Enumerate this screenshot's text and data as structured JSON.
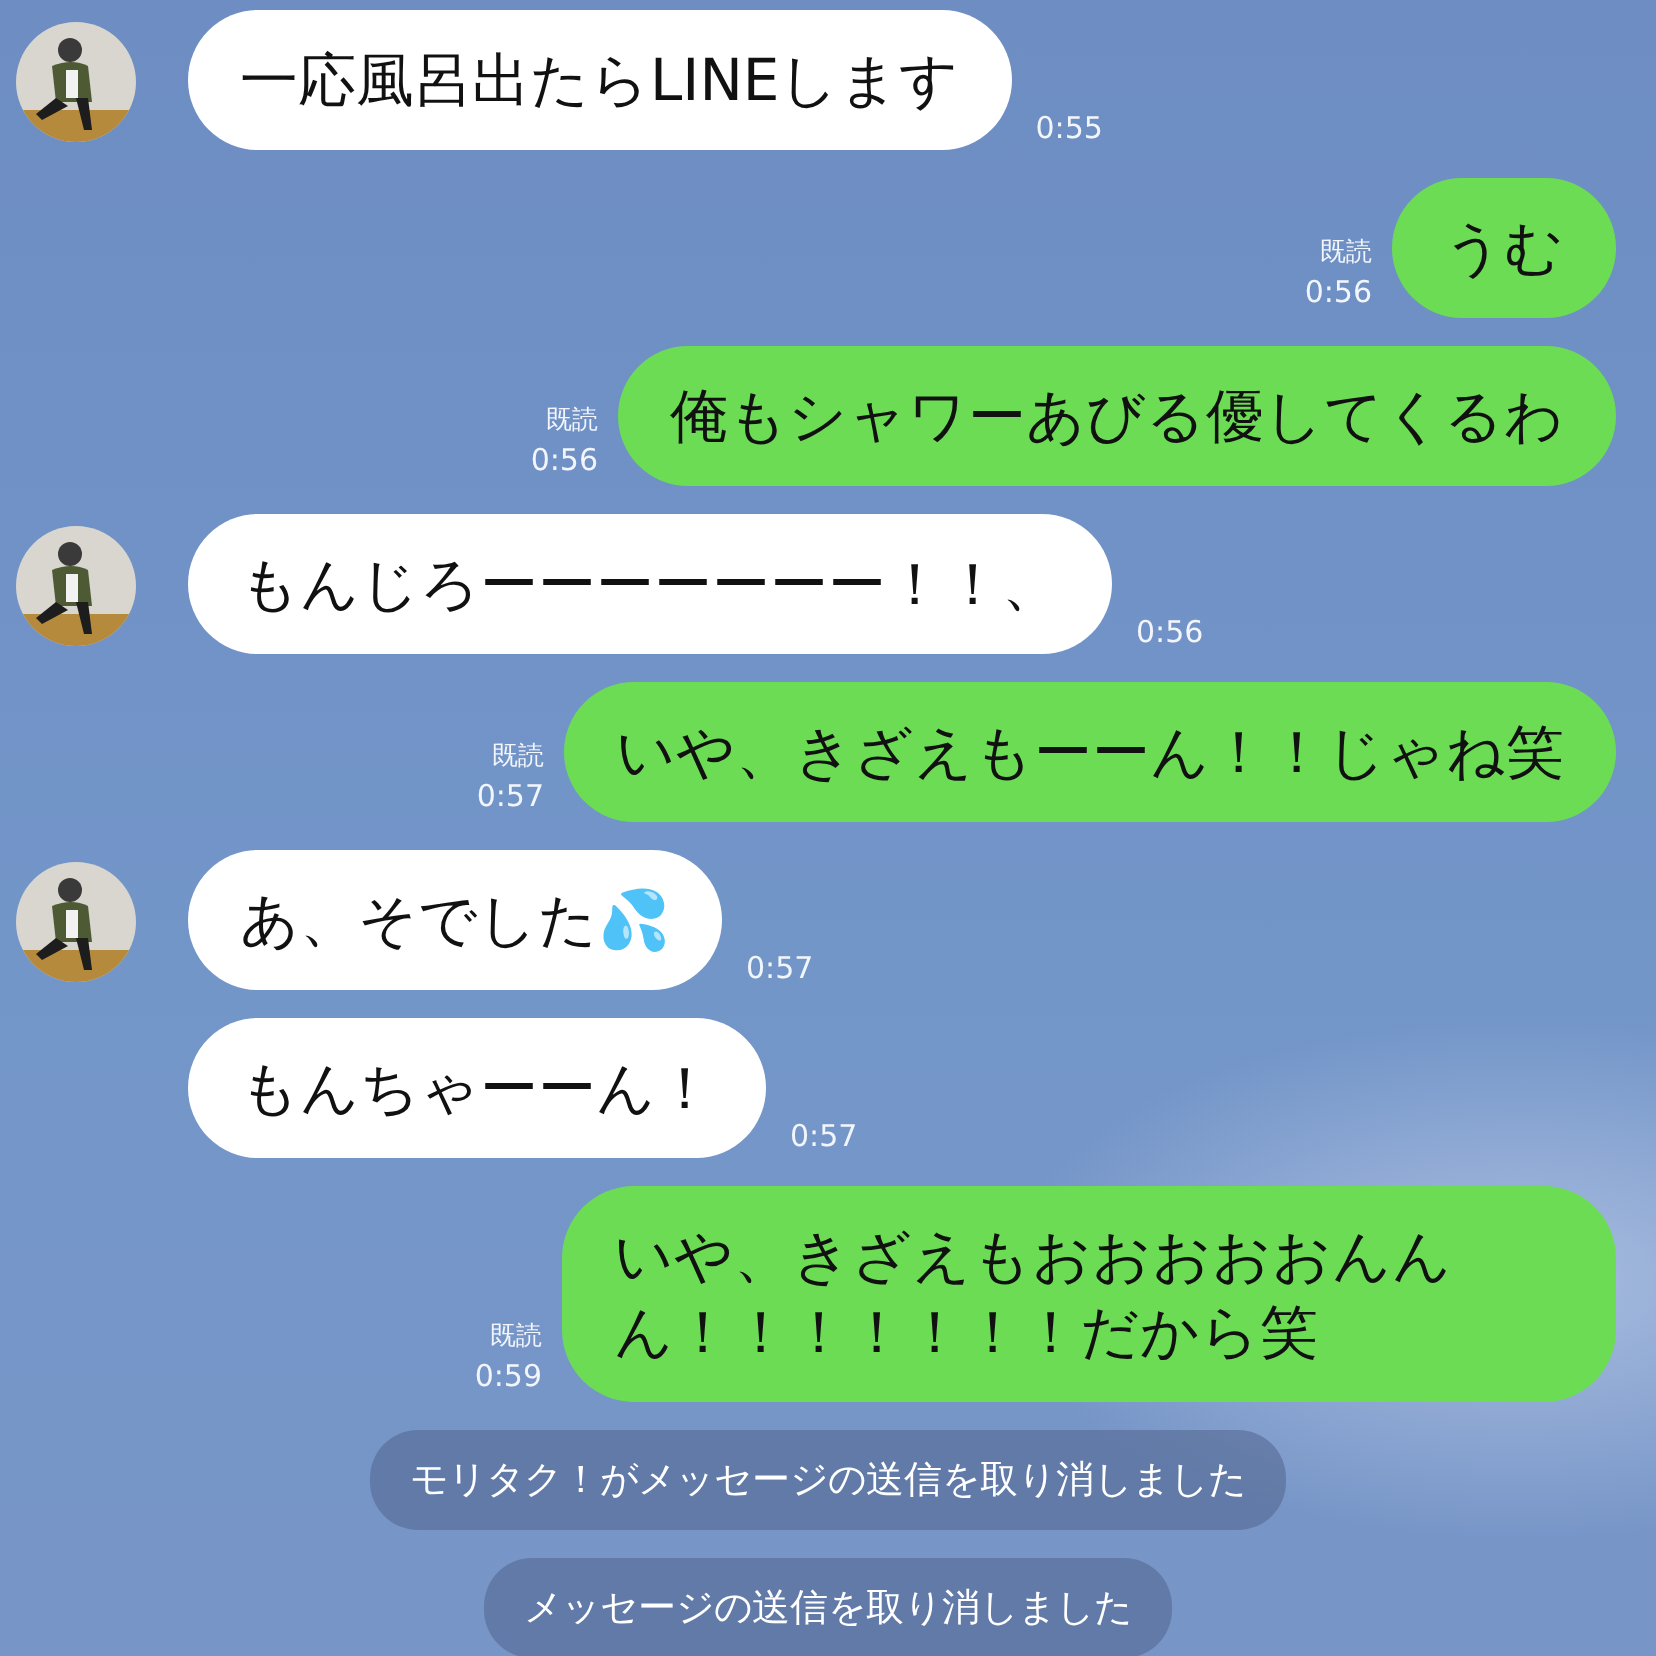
{
  "messages": [
    {
      "kind": "received",
      "avatar": true,
      "text": "一応風呂出たらLINEします",
      "time": "0:55"
    },
    {
      "kind": "sent",
      "read": "既読",
      "text": "うむ",
      "time": "0:56"
    },
    {
      "kind": "sent",
      "read": "既読",
      "text": "俺もシャワーあびる優してくるわ",
      "time": "0:56"
    },
    {
      "kind": "received",
      "avatar": true,
      "text": "もんじろーーーーーーー！！、",
      "time": "0:56"
    },
    {
      "kind": "sent",
      "read": "既読",
      "text": "いや、きざえもーーん！！じゃね笑",
      "time": "0:57"
    },
    {
      "kind": "received",
      "avatar": true,
      "text": "あ、そでした💦",
      "time": "0:57"
    },
    {
      "kind": "received",
      "avatar": false,
      "text": "もんちゃーーん！",
      "time": "0:57"
    },
    {
      "kind": "sent",
      "read": "既読",
      "text": "いや、きざえもおおおおおんんん！！！！！！！だから笑",
      "time": "0:59"
    },
    {
      "kind": "system",
      "text": "モリタク！がメッセージの送信を取り消しました"
    },
    {
      "kind": "system",
      "text": "メッセージの送信を取り消しました"
    }
  ]
}
